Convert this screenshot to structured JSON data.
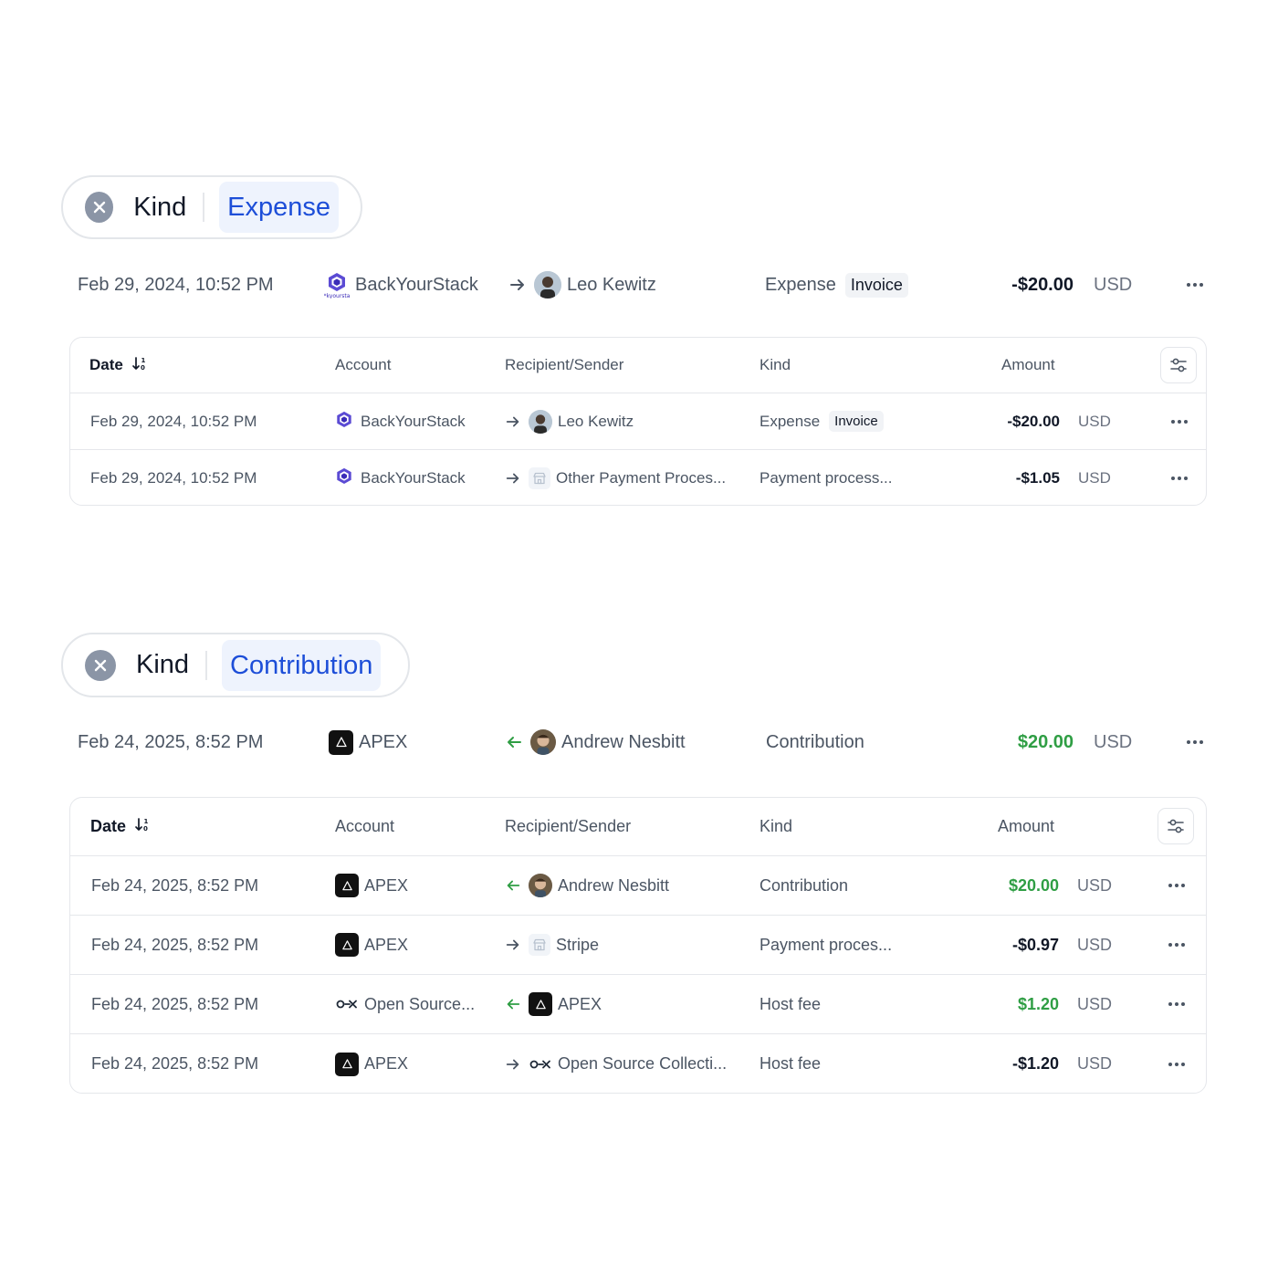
{
  "section1": {
    "filter": {
      "key": "Kind",
      "value": "Expense"
    },
    "focus": {
      "date": "Feb 29, 2024, 10:52 PM",
      "account": "BackYourStack",
      "direction": "out",
      "counterparty": "Leo Kewitz",
      "kind": "Expense",
      "badge": "Invoice",
      "amount": "-$20.00",
      "currency": "USD"
    },
    "table": {
      "headers": {
        "date": "Date",
        "account": "Account",
        "party": "Recipient/Sender",
        "kind": "Kind",
        "amount": "Amount"
      },
      "rows": [
        {
          "date": "Feb 29, 2024, 10:52 PM",
          "account": "BackYourStack",
          "direction": "out",
          "party": "Leo Kewitz",
          "kind": "Expense",
          "badge": "Invoice",
          "amount": "-$20.00",
          "currency": "USD"
        },
        {
          "date": "Feb 29, 2024, 10:52 PM",
          "account": "BackYourStack",
          "direction": "out",
          "party": "Other Payment Proces...",
          "kind": "Payment process...",
          "amount": "-$1.05",
          "currency": "USD"
        }
      ]
    }
  },
  "section2": {
    "filter": {
      "key": "Kind",
      "value": "Contribution"
    },
    "focus": {
      "date": "Feb 24, 2025, 8:52 PM",
      "account": "APEX",
      "direction": "in",
      "counterparty": "Andrew Nesbitt",
      "kind": "Contribution",
      "amount": "$20.00",
      "currency": "USD"
    },
    "table": {
      "headers": {
        "date": "Date",
        "account": "Account",
        "party": "Recipient/Sender",
        "kind": "Kind",
        "amount": "Amount"
      },
      "rows": [
        {
          "date": "Feb 24, 2025, 8:52 PM",
          "account": "APEX",
          "direction": "in",
          "party": "Andrew Nesbitt",
          "kind": "Contribution",
          "amount": "$20.00",
          "currency": "USD"
        },
        {
          "date": "Feb 24, 2025, 8:52 PM",
          "account": "APEX",
          "direction": "out",
          "party": "Stripe",
          "kind": "Payment proces...",
          "amount": "-$0.97",
          "currency": "USD"
        },
        {
          "date": "Feb 24, 2025, 8:52 PM",
          "account": "Open Source...",
          "direction": "in",
          "party": "APEX",
          "kind": "Host fee",
          "amount": "$1.20",
          "currency": "USD"
        },
        {
          "date": "Feb 24, 2025, 8:52 PM",
          "account": "APEX",
          "direction": "out",
          "party": "Open Source Collecti...",
          "kind": "Host fee",
          "amount": "-$1.20",
          "currency": "USD"
        }
      ]
    }
  },
  "colors": {
    "accent": "#1d4ed8",
    "positive": "#2f9e44",
    "incoming_arrow": "#2f9e44",
    "text_muted": "#4b5563"
  },
  "icons": {
    "clear_filter": "close-circle-icon",
    "sort": "sort-descending-icon",
    "table_settings": "sliders-icon",
    "more": "ellipsis-icon",
    "outgoing": "arrow-right-icon",
    "incoming": "arrow-left-icon"
  }
}
